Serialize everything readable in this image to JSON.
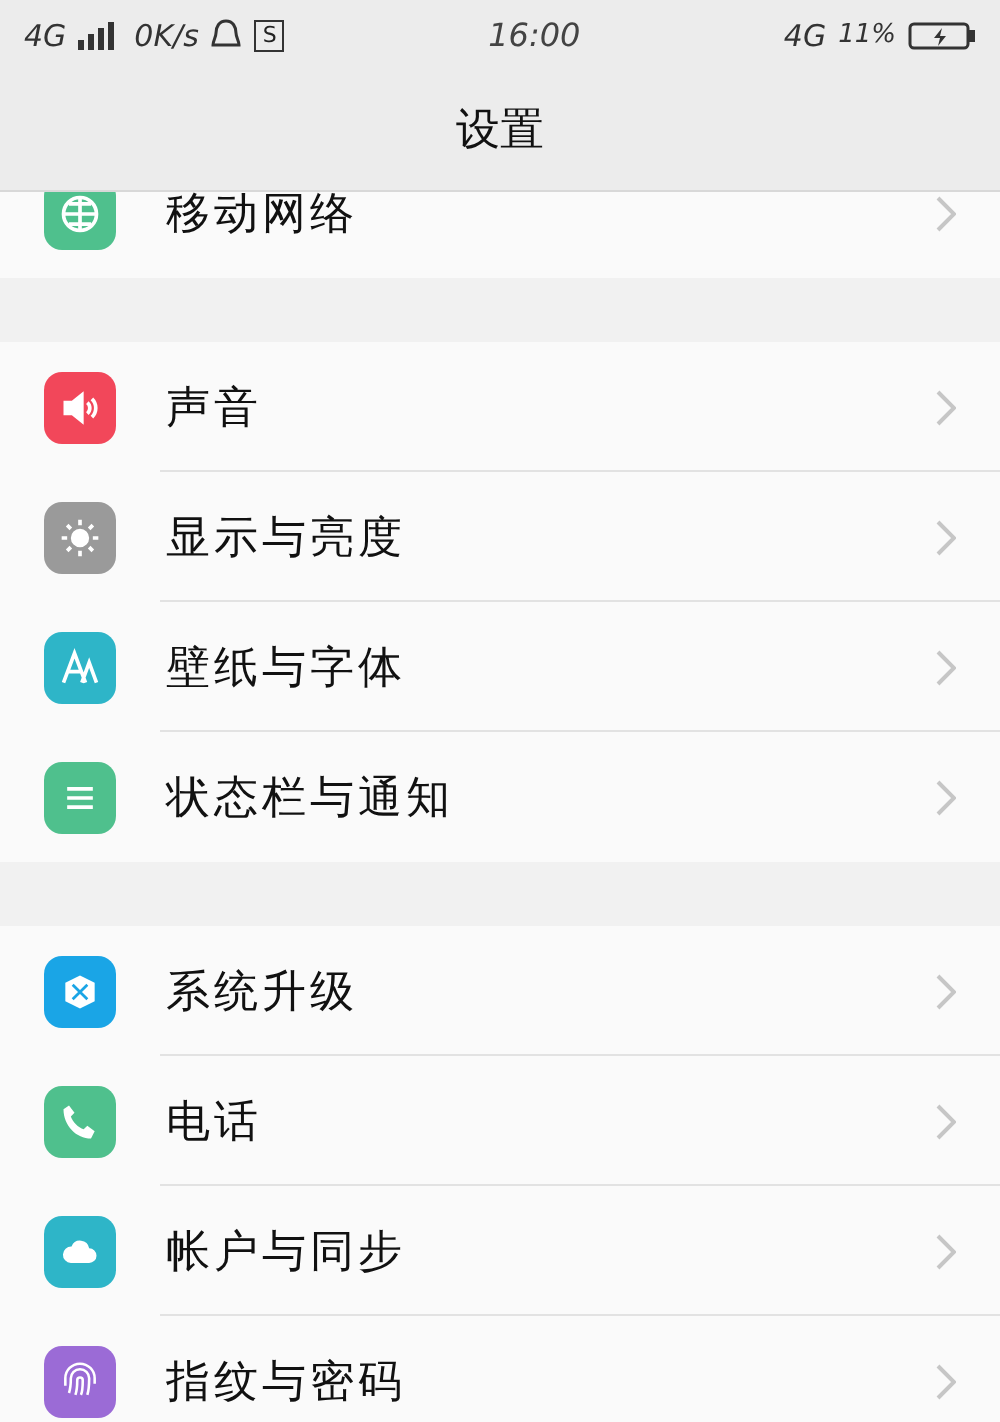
{
  "status_bar": {
    "network_left": "4G",
    "speed": "0K/s",
    "app_badge": "S",
    "time": "16:00",
    "network_right": "4G",
    "battery": "11%"
  },
  "title": "设置",
  "sections": [
    {
      "items": [
        {
          "label": "移动网络",
          "kind": "globe",
          "color": "#4fc08d"
        }
      ]
    },
    {
      "items": [
        {
          "label": "声音",
          "kind": "sound",
          "color": "#f2475a"
        },
        {
          "label": "显示与亮度",
          "kind": "sun",
          "color": "#9a9a9a"
        },
        {
          "label": "壁纸与字体",
          "kind": "font",
          "color": "#2eb5c8"
        },
        {
          "label": "状态栏与通知",
          "kind": "lines",
          "color": "#4fc08d"
        }
      ]
    },
    {
      "items": [
        {
          "label": "系统升级",
          "kind": "cube",
          "color": "#1aa5e6"
        },
        {
          "label": "电话",
          "kind": "phone",
          "color": "#4fc08d"
        },
        {
          "label": "帐户与同步",
          "kind": "cloud",
          "color": "#2eb5c8"
        },
        {
          "label": "指纹与密码",
          "kind": "finger",
          "color": "#9b6bd6"
        }
      ]
    }
  ]
}
